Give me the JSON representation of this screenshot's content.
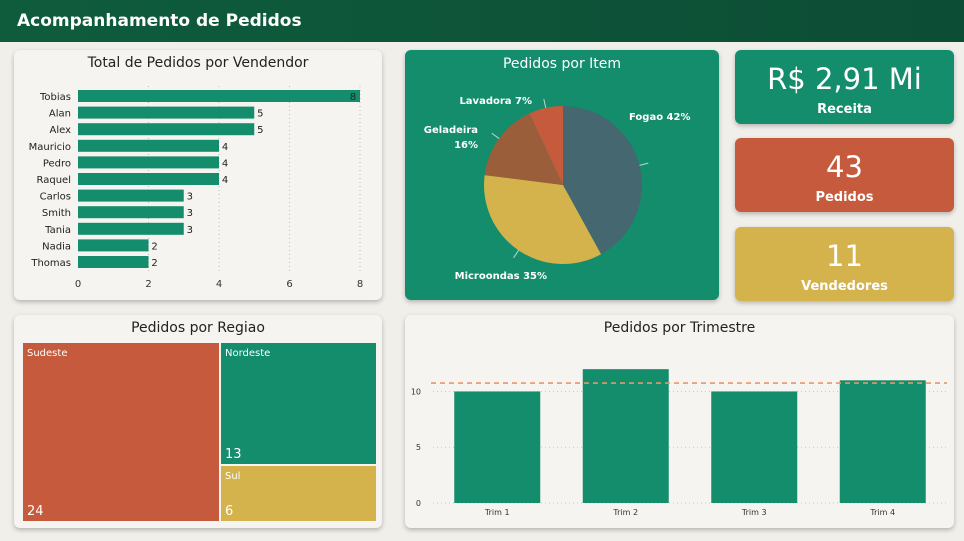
{
  "header": {
    "title": "Acompanhamento de Pedidos"
  },
  "colors": {
    "green": "#138d6c",
    "red": "#c55a3c",
    "yellow": "#d4b24c",
    "slate": "#45676f",
    "brown": "#9b5e3a",
    "header": "#0f5c3d"
  },
  "kpis": [
    {
      "value": "R$ 2,91 Mi",
      "label": "Receita",
      "color": "#138d6c"
    },
    {
      "value": "43",
      "label": "Pedidos",
      "color": "#c55a3c"
    },
    {
      "value": "11",
      "label": "Vendedores",
      "color": "#d4b24c"
    }
  ],
  "chart_data": [
    {
      "type": "bar",
      "orientation": "horizontal",
      "title": "Total de Pedidos por Vendendor",
      "categories": [
        "Tobias",
        "Alan",
        "Alex",
        "Mauricio",
        "Pedro",
        "Raquel",
        "Carlos",
        "Smith",
        "Tania",
        "Nadia",
        "Thomas"
      ],
      "values": [
        8,
        5,
        5,
        4,
        4,
        4,
        3,
        3,
        3,
        2,
        2
      ],
      "xlim": [
        0,
        8
      ],
      "xticks": [
        "0",
        "2",
        "4",
        "6",
        "8"
      ],
      "data_labels": true,
      "grid": "vertical dotted",
      "color": "#138d6c"
    },
    {
      "type": "pie",
      "title": "Pedidos por Item",
      "slices": [
        {
          "name": "Fogao",
          "label": "Fogao 42%",
          "value": 42,
          "color": "#45676f"
        },
        {
          "name": "Microondas",
          "label": "Microondas 35%",
          "value": 35,
          "color": "#d4b24c"
        },
        {
          "name": "Geladeira",
          "label": "Geladeira 16%",
          "value": 16,
          "color": "#9b5e3a"
        },
        {
          "name": "Lavadora",
          "label": "Lavadora 7%",
          "value": 7,
          "color": "#c55a3c"
        }
      ]
    },
    {
      "type": "treemap",
      "title": "Pedidos por Regiao",
      "items": [
        {
          "name": "Sudeste",
          "value": 24,
          "color": "#c55a3c"
        },
        {
          "name": "Nordeste",
          "value": 13,
          "color": "#138d6c"
        },
        {
          "name": "Sul",
          "value": 6,
          "color": "#d4b24c"
        }
      ]
    },
    {
      "type": "bar",
      "title": "Pedidos por Trimestre",
      "categories": [
        "Trim 1",
        "Trim 2",
        "Trim 3",
        "Trim 4"
      ],
      "values": [
        10,
        12,
        10,
        11
      ],
      "ylim": [
        0,
        13
      ],
      "yticks": [
        "0",
        "5",
        "10"
      ],
      "reference_line": {
        "value": 10.75,
        "style": "dashed",
        "color": "#e8966b"
      },
      "grid": "horizontal dotted",
      "color": "#138d6c"
    }
  ]
}
